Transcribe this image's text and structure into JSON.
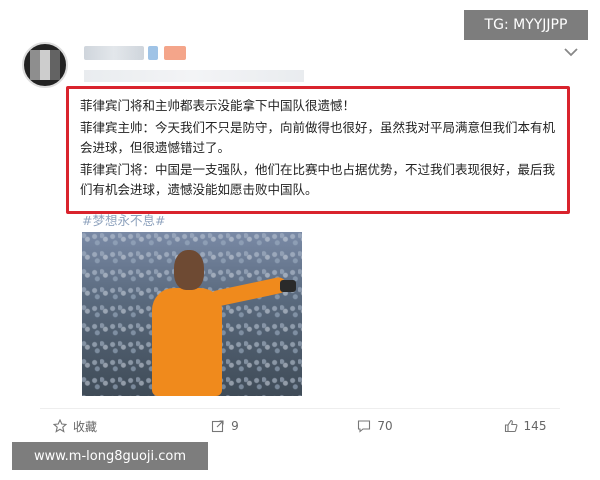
{
  "watermarks": {
    "top": "TG: MYYJJPP",
    "bottom": "www.m-long8guoji.com"
  },
  "post": {
    "lines": [
      "菲律宾门将和主帅都表示没能拿下中国队很遗憾！",
      "菲律宾主帅：今天我们不只是防守，向前做得也很好，虽然我对平局满意但我们本有机会进球，但很遗憾错过了。",
      "菲律宾门将：中国是一支强队，他们在比赛中也占据优势，不过我们表现很好，最后我们有机会进球，遗憾没能如愿击败中国队。"
    ],
    "hashtag": "#梦想永不息#"
  },
  "actions": {
    "favorite": "收藏",
    "repost": "9",
    "comment": "70",
    "like": "145"
  },
  "colors": {
    "highlight": "#d9232d",
    "jersey": "#f08a1c",
    "watermark_bg": "#7d7d7d"
  }
}
